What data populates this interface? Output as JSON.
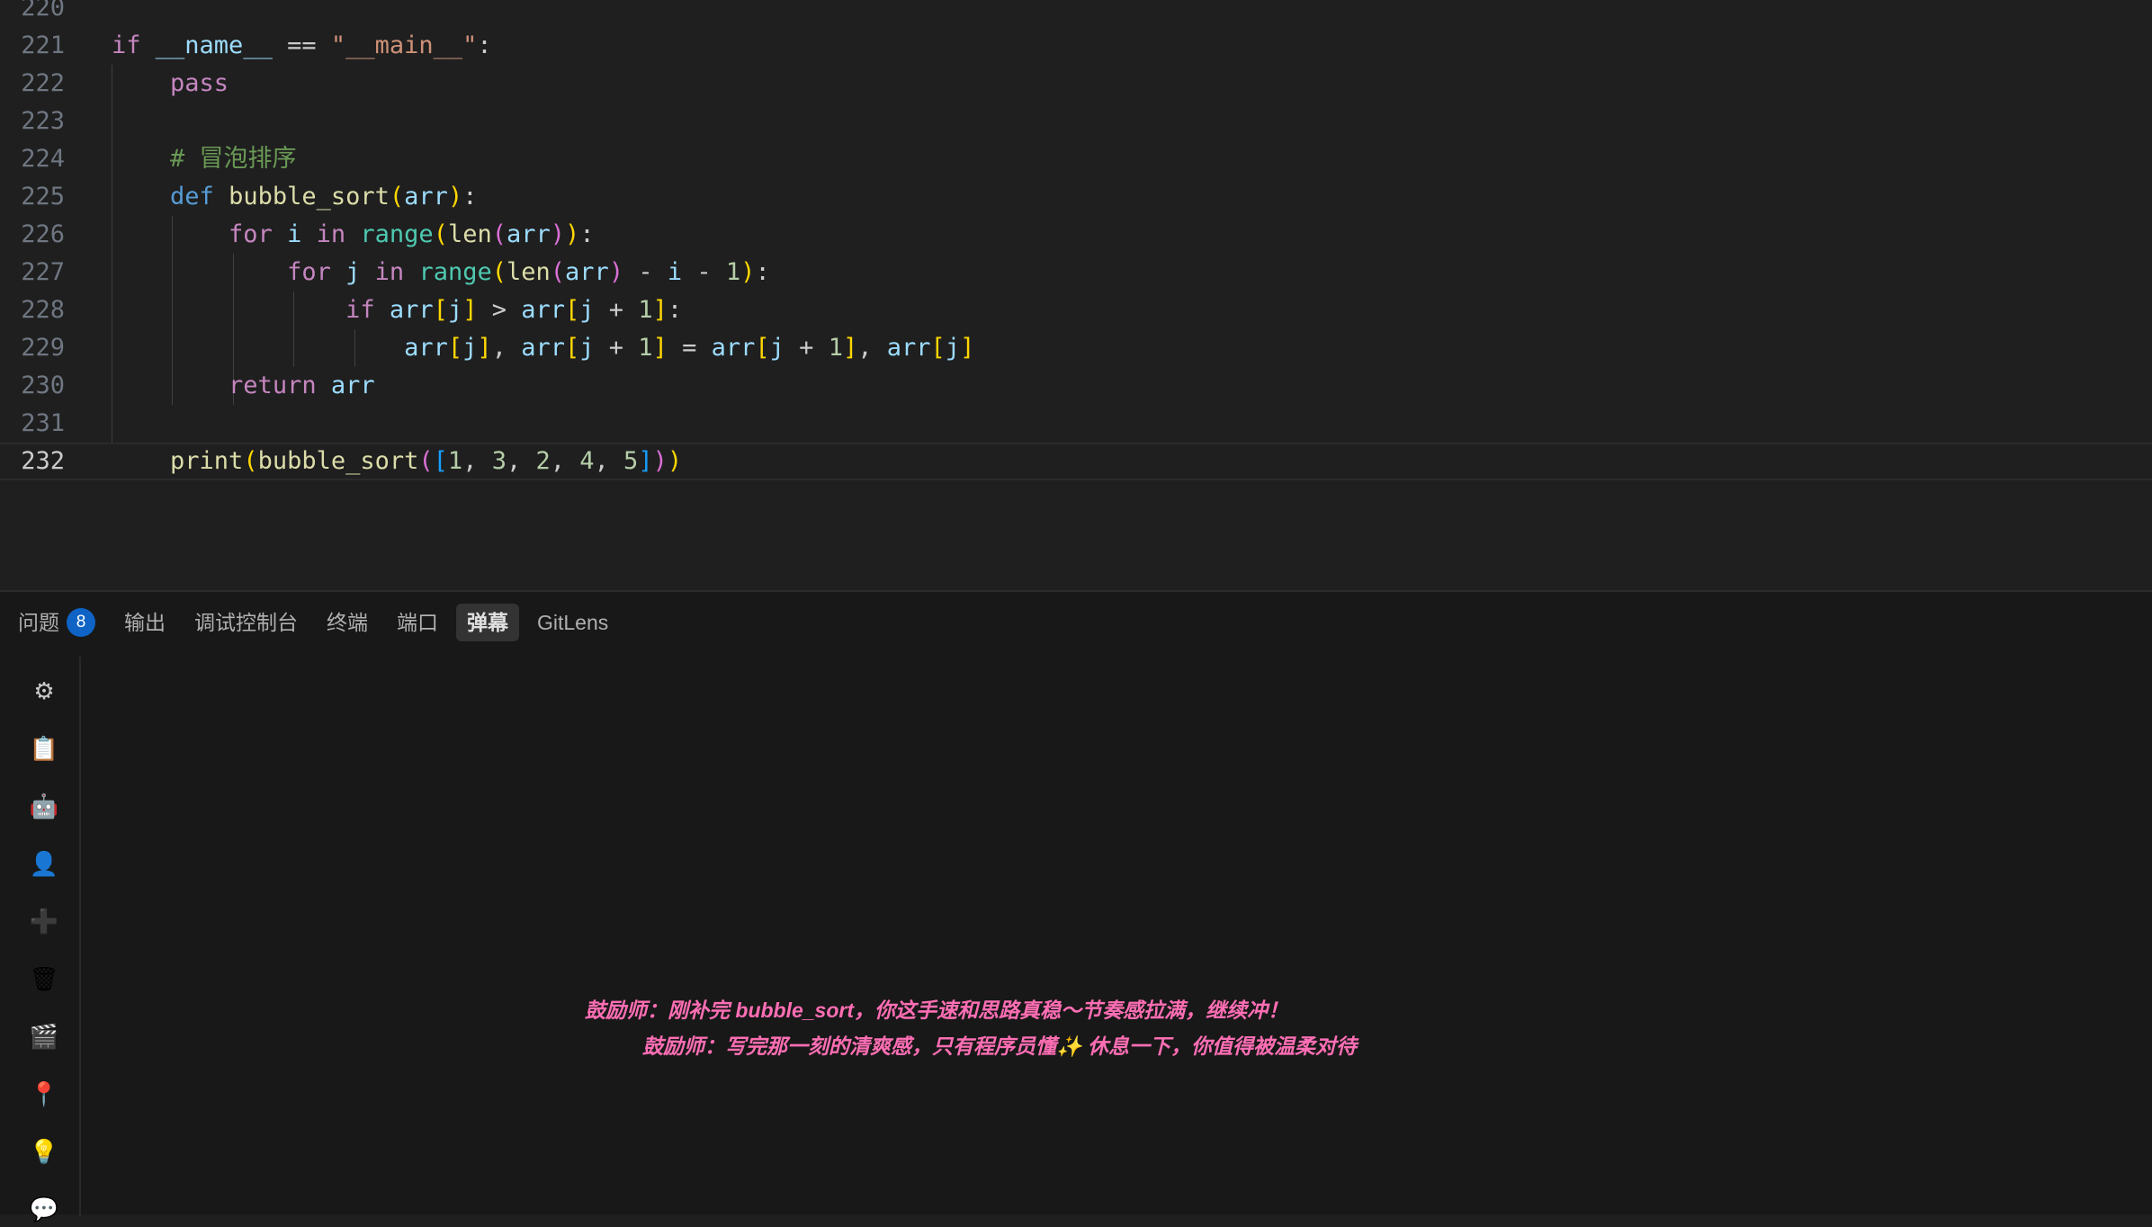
{
  "editor": {
    "lines": [
      {
        "number": "220",
        "code": ""
      },
      {
        "number": "221",
        "code": "if __name__ == \"__main__\":"
      },
      {
        "number": "222",
        "code": "    pass"
      },
      {
        "number": "223",
        "code": ""
      },
      {
        "number": "224",
        "code": "    # 冒泡排序"
      },
      {
        "number": "225",
        "code": "    def bubble_sort(arr):"
      },
      {
        "number": "226",
        "code": "        for i in range(len(arr)):"
      },
      {
        "number": "227",
        "code": "            for j in range(len(arr) - i - 1):"
      },
      {
        "number": "228",
        "code": "                if arr[j] > arr[j + 1]:"
      },
      {
        "number": "229",
        "code": "                    arr[j], arr[j + 1] = arr[j + 1], arr[j]"
      },
      {
        "number": "230",
        "code": "        return arr"
      },
      {
        "number": "231",
        "code": ""
      },
      {
        "number": "232",
        "code": "    print(bubble_sort([1, 3, 2, 4, 5]))"
      }
    ],
    "current_line": "232"
  },
  "panel": {
    "tabs": [
      {
        "label": "问题",
        "badge": "8"
      },
      {
        "label": "输出"
      },
      {
        "label": "调试控制台"
      },
      {
        "label": "终端"
      },
      {
        "label": "端口"
      },
      {
        "label": "弹幕",
        "active": true
      },
      {
        "label": "GitLens"
      }
    ],
    "toolbar_icons": [
      "gear-icon",
      "clipboard-icon",
      "robot-icon",
      "user-icon",
      "plus-icon",
      "trash-icon",
      "clapperboard-icon",
      "pin-icon",
      "lightbulb-icon",
      "chat-icon"
    ],
    "toolbar_glyphs": [
      "⚙",
      "📋",
      "🤖",
      "👤",
      "➕",
      "🗑",
      "🎬",
      "📍",
      "💡",
      "💬"
    ],
    "danmaku": [
      {
        "text": "鼓励师：刚补完 bubble_sort，你这手速和思路真稳～节奏感拉满，继续冲！"
      },
      {
        "text": "鼓励师：写完那一刻的清爽感，只有程序员懂✨ 休息一下，你值得被温柔对待"
      }
    ]
  },
  "colors": {
    "editor_bg": "#1f1f1f",
    "panel_bg": "#181818",
    "danmaku_color": "#ff6eb4",
    "badge_bg": "#0e63c5"
  }
}
